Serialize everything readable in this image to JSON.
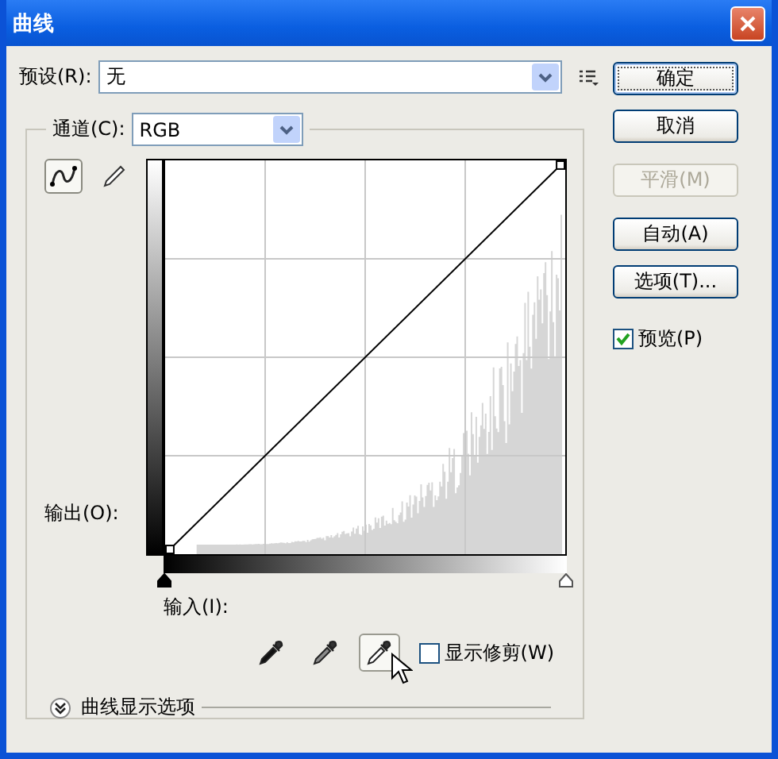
{
  "window": {
    "title": "曲线"
  },
  "preset": {
    "label": "预设(R):",
    "value": "无"
  },
  "channel": {
    "label": "通道(C):",
    "value": "RGB"
  },
  "curve_tools": [
    {
      "kind": "curve",
      "selected": true
    },
    {
      "kind": "pencil",
      "selected": false
    }
  ],
  "graph": {
    "output_label": "输出(O):",
    "input_label": "输入(I):"
  },
  "eyedroppers": [
    {
      "kind": "black",
      "selected": false
    },
    {
      "kind": "gray",
      "selected": false
    },
    {
      "kind": "white",
      "selected": true
    }
  ],
  "show_clipping": {
    "label": "显示修剪(W)",
    "checked": false
  },
  "display_options": {
    "label": "曲线显示选项",
    "expanded": false
  },
  "buttons": [
    {
      "label": "确定",
      "default": true,
      "disabled": false
    },
    {
      "label": "取消",
      "default": false,
      "disabled": false
    },
    {
      "label": "平滑(M)",
      "default": false,
      "disabled": true
    },
    {
      "label": "自动(A)",
      "default": false,
      "disabled": false
    },
    {
      "label": "选项(T)...",
      "default": false,
      "disabled": false
    }
  ],
  "preview": {
    "label": "预览(P)",
    "checked": true
  }
}
